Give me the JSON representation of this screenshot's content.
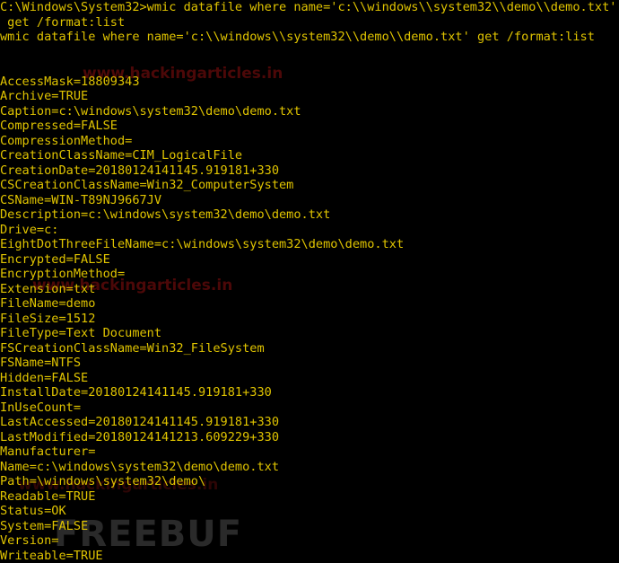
{
  "terminal": {
    "text_color": "#e0c400",
    "background": "#000000",
    "lines": [
      "C:\\Windows\\System32>wmic datafile where name='c:\\\\windows\\\\system32\\\\demo\\\\demo.txt'",
      " get /format:list",
      "wmic datafile where name='c:\\\\windows\\\\system32\\\\demo\\\\demo.txt' get /format:list",
      "",
      "",
      "AccessMask=18809343",
      "Archive=TRUE",
      "Caption=c:\\windows\\system32\\demo\\demo.txt",
      "Compressed=FALSE",
      "CompressionMethod=",
      "CreationClassName=CIM_LogicalFile",
      "CreationDate=20180124141145.919181+330",
      "CSCreationClassName=Win32_ComputerSystem",
      "CSName=WIN-T89NJ9667JV",
      "Description=c:\\windows\\system32\\demo\\demo.txt",
      "Drive=c:",
      "EightDotThreeFileName=c:\\windows\\system32\\demo\\demo.txt",
      "Encrypted=FALSE",
      "EncryptionMethod=",
      "Extension=txt",
      "FileName=demo",
      "FileSize=1512",
      "FileType=Text Document",
      "FSCreationClassName=Win32_FileSystem",
      "FSName=NTFS",
      "Hidden=FALSE",
      "InstallDate=20180124141145.919181+330",
      "InUseCount=",
      "LastAccessed=20180124141145.919181+330",
      "LastModified=20180124141213.609229+330",
      "Manufacturer=",
      "Name=c:\\windows\\system32\\demo\\demo.txt",
      "Path=\\windows\\system32\\demo\\",
      "Readable=TRUE",
      "Status=OK",
      "System=FALSE",
      "Version=",
      "Writeable=TRUE"
    ]
  },
  "watermarks": {
    "site": "www.hackingarticles.in",
    "brand": "FREEBUF"
  }
}
